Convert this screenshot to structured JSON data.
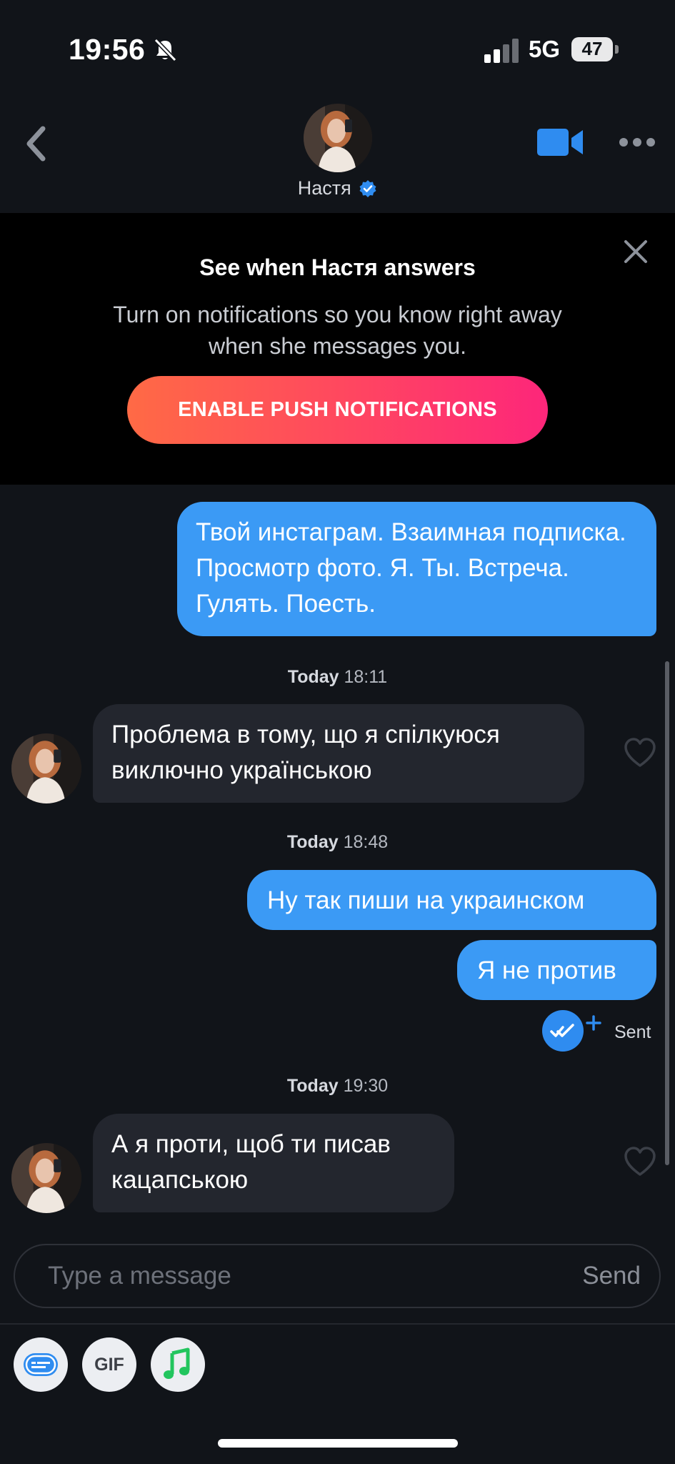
{
  "status_bar": {
    "time": "19:56",
    "network": "5G",
    "battery": "47"
  },
  "header": {
    "name": "Настя",
    "verified": true
  },
  "banner": {
    "title": "See when Настя answers",
    "text": "Turn on notifications so you know right away when she messages you.",
    "button_label": "ENABLE PUSH NOTIFICATIONS"
  },
  "messages": [
    {
      "direction": "outgoing",
      "text": "Твой инстаграм. Взаимная подписка. Просмотр фото. Я. Ты. Встреча.  Гулять. Поесть."
    },
    {
      "type": "timestamp",
      "day": "Today",
      "time": "18:11"
    },
    {
      "direction": "incoming",
      "text": "Проблема в тому, що я спілкуюся виключно українською"
    },
    {
      "type": "timestamp",
      "day": "Today",
      "time": "18:48"
    },
    {
      "direction": "outgoing",
      "text": "Ну так пиши на украинском"
    },
    {
      "direction": "outgoing",
      "text": "Я не против"
    },
    {
      "type": "timestamp",
      "day": "Today",
      "time": "19:30"
    },
    {
      "direction": "incoming",
      "text": "А я проти, щоб ти писав кацапською"
    }
  ],
  "read_status": "Sent",
  "composer": {
    "placeholder": "Type a message",
    "send_label": "Send"
  },
  "tools": {
    "gif_label": "GIF"
  },
  "colors": {
    "background": "#111419",
    "outgoing_bubble": "#3b9af5",
    "incoming_bubble": "#23262e",
    "accent_blue": "#2f8cf0",
    "gradient_start": "#ff6a45",
    "gradient_end": "#fd267a"
  },
  "icons": [
    "bell-slash-icon",
    "signal-icon",
    "battery-icon",
    "back-chevron-icon",
    "verified-badge-icon",
    "video-camera-icon",
    "more-dots-icon",
    "close-icon",
    "heart-icon",
    "read-receipt-icon",
    "sticker-icon",
    "music-note-icon"
  ]
}
